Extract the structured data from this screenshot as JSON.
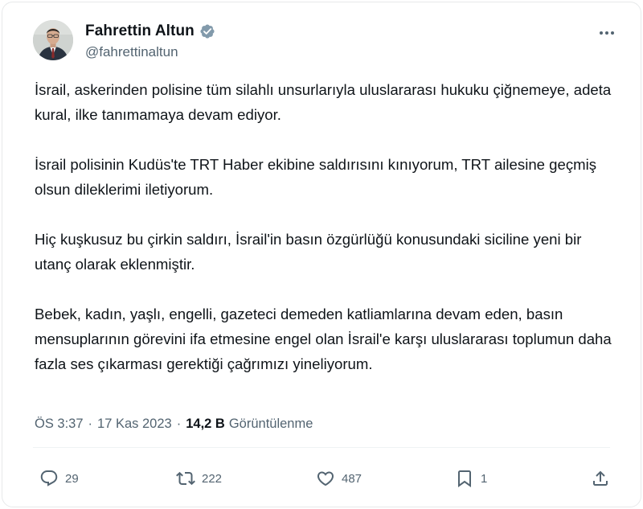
{
  "author": {
    "name": "Fahrettin Altun",
    "handle": "@fahrettinaltun",
    "verified_color": "#829aab"
  },
  "tweet": {
    "paragraphs": [
      "İsrail, askerinden polisine tüm silahlı unsurlarıyla uluslararası hukuku çiğnemeye, adeta kural, ilke tanımamaya devam ediyor.",
      "İsrail polisinin Kudüs'te TRT Haber ekibine saldırısını kınıyorum, TRT ailesine geçmiş olsun dileklerimi iletiyorum.",
      "Hiç kuşkusuz bu çirkin saldırı, İsrail'in basın özgürlüğü konusundaki siciline yeni bir utanç olarak eklenmiştir.",
      "Bebek, kadın, yaşlı, engelli, gazeteci demeden katliamlarına devam eden, basın mensuplarının görevini ifa etmesine engel olan İsrail'e karşı uluslararası toplumun daha fazla ses çıkarması gerektiği çağrımızı yineliyorum."
    ],
    "time": "ÖS 3:37",
    "date": "17 Kas 2023",
    "views_count": "14,2 B",
    "views_label": "Görüntülenme"
  },
  "actions": {
    "replies": "29",
    "retweets": "222",
    "likes": "487",
    "bookmarks": "1"
  },
  "icons": [
    "verified-badge-icon",
    "more-icon",
    "reply-icon",
    "retweet-icon",
    "like-icon",
    "bookmark-icon",
    "share-icon"
  ],
  "colors": {
    "text": "#0f1419",
    "secondary": "#536471",
    "border": "#e7e9ea"
  }
}
